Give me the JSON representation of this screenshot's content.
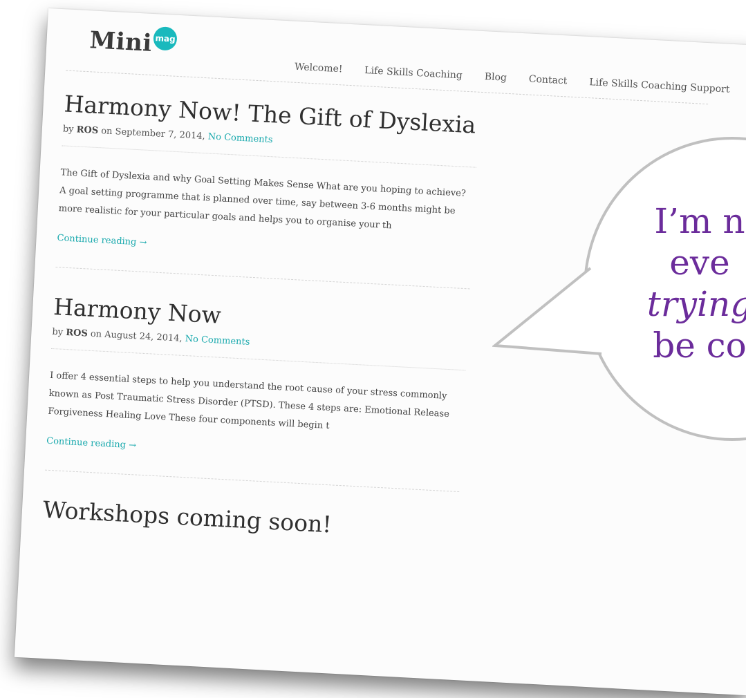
{
  "site": {
    "logo_text": "Mini",
    "logo_badge": "mag",
    "accent_color": "#19b9bd"
  },
  "nav": {
    "items": [
      {
        "label": "Welcome!"
      },
      {
        "label": "Life Skills Coaching"
      },
      {
        "label": "Blog"
      },
      {
        "label": "Contact"
      },
      {
        "label": "Life Skills Coaching Support"
      }
    ]
  },
  "posts": [
    {
      "title": "Harmony Now! The Gift of Dyslexia",
      "by": "by",
      "author": "ROS",
      "on": "on",
      "date": "September 7, 2014,",
      "comments": "No Comments",
      "excerpt": "The Gift of Dyslexia and why Goal Setting Makes Sense What are you hoping to achieve? A goal setting programme that is planned over time, say between 3-6 months might be more realistic for your particular goals and helps you to organise your th",
      "read_more": "Continue reading →"
    },
    {
      "title": "Harmony Now",
      "by": "by",
      "author": "ROS",
      "on": "on",
      "date": "August 24, 2014,",
      "comments": "No Comments",
      "excerpt": "I offer 4 essential steps to help you understand the root cause of your stress commonly known as Post Traumatic Stress Disorder (PTSD). These 4 steps are: Emotional Release Forgiveness Healing Love These four components will begin t",
      "read_more": "Continue reading →"
    },
    {
      "title": "Workshops coming soon!"
    }
  ],
  "bubble": {
    "line1": "I’m n",
    "line2": "eve",
    "line3": "trying",
    "line4": "be co",
    "text_color": "#6b2c9b"
  }
}
